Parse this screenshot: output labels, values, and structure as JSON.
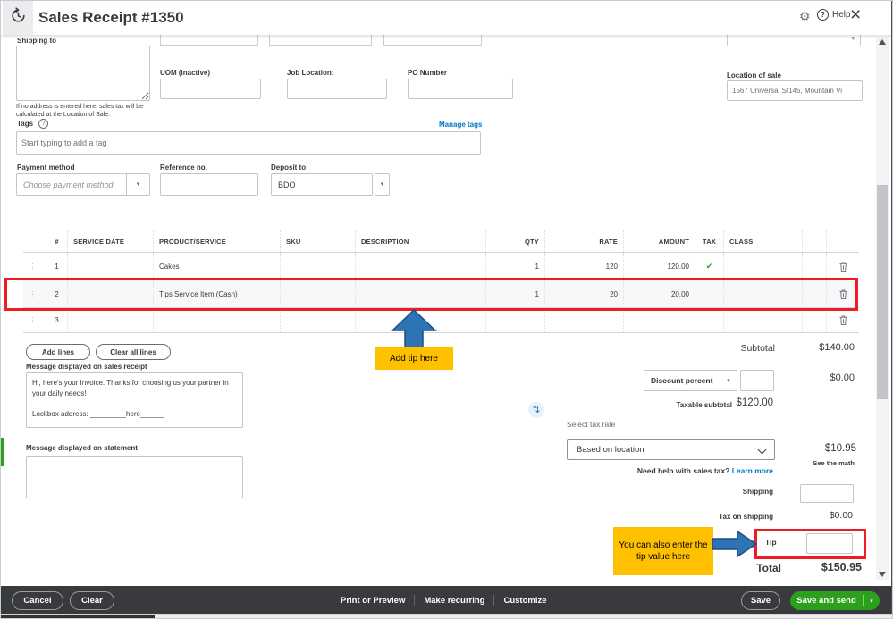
{
  "header": {
    "title": "Sales Receipt #1350",
    "help_label": "Help"
  },
  "icons": {
    "gear": "⚙",
    "question": "?",
    "close": "×",
    "caret": "▾",
    "check": "✔",
    "swap": "⇅",
    "drag": "⋮⋮"
  },
  "form": {
    "shipping_to_label": "Shipping to",
    "shipping_note": "If no address is entered here, sales tax will be calculated at the Location of Sale.",
    "uom_label": "UOM (inactive)",
    "job_location_label": "Job Location:",
    "po_number_label": "PO Number",
    "location_of_sale_label": "Location of sale",
    "location_of_sale_value": "1567 Universal St145, Mountain Vi",
    "tags_label": "Tags",
    "manage_tags_label": "Manage tags",
    "tags_placeholder": "Start typing to add a tag",
    "payment_method_label": "Payment method",
    "payment_method_placeholder": "Choose payment method",
    "reference_no_label": "Reference no.",
    "deposit_to_label": "Deposit to",
    "deposit_to_value": "BDO"
  },
  "table": {
    "headers": [
      "#",
      "SERVICE DATE",
      "PRODUCT/SERVICE",
      "SKU",
      "DESCRIPTION",
      "QTY",
      "RATE",
      "AMOUNT",
      "TAX",
      "CLASS"
    ],
    "rows": [
      {
        "num": "1",
        "service_date": "",
        "product": "Cakes",
        "sku": "",
        "description": "",
        "qty": "1",
        "rate": "120",
        "amount": "120.00",
        "class": ""
      },
      {
        "num": "2",
        "service_date": "",
        "product": "Tips Service Item (Cash)",
        "sku": "",
        "description": "",
        "qty": "1",
        "rate": "20",
        "amount": "20.00",
        "class": ""
      },
      {
        "num": "3",
        "service_date": "",
        "product": "",
        "sku": "",
        "description": "",
        "qty": "",
        "rate": "",
        "amount": "",
        "class": ""
      }
    ],
    "add_lines_label": "Add lines",
    "clear_all_lines_label": "Clear all lines"
  },
  "callouts": {
    "add_tip_here": "Add tip here",
    "tip_value_here": "You can also enter the tip value here"
  },
  "messages": {
    "sales_receipt_label": "Message displayed on sales receipt",
    "sales_receipt_value": "Hi, here's your Invoice. Thanks for choosing us your partner in your daily needs!\n\nLockbox address: _________here______",
    "statement_label": "Message displayed on statement"
  },
  "totals": {
    "subtotal_label": "Subtotal",
    "subtotal_value": "$140.00",
    "discount_option": "Discount percent",
    "discount_value": "$0.00",
    "taxable_subtotal_label": "Taxable subtotal",
    "taxable_subtotal_value": "$120.00",
    "select_tax_rate_label": "Select tax rate",
    "tax_rate_option": "Based on location",
    "tax_value": "$10.95",
    "see_the_math_label": "See the math",
    "sales_tax_help_text": "Need help with sales tax?",
    "learn_more_label": "Learn more",
    "shipping_label": "Shipping",
    "tax_on_shipping_label": "Tax on shipping",
    "tax_on_shipping_value": "$0.00",
    "tip_label": "Tip",
    "total_label": "Total",
    "total_value": "$150.95"
  },
  "footer": {
    "cancel_label": "Cancel",
    "clear_label": "Clear",
    "print_or_preview_label": "Print or Preview",
    "make_recurring_label": "Make recurring",
    "customize_label": "Customize",
    "save_label": "Save",
    "save_and_send_label": "Save and send"
  },
  "colors": {
    "qb_green": "#2ca01c",
    "link_blue": "#0077c5",
    "highlight_red": "#ee1c25",
    "callout_yellow": "#ffc000",
    "arrow_blue": "#2e74b5",
    "footer_dark": "#393a3d",
    "text_dark": "#393a3d"
  }
}
